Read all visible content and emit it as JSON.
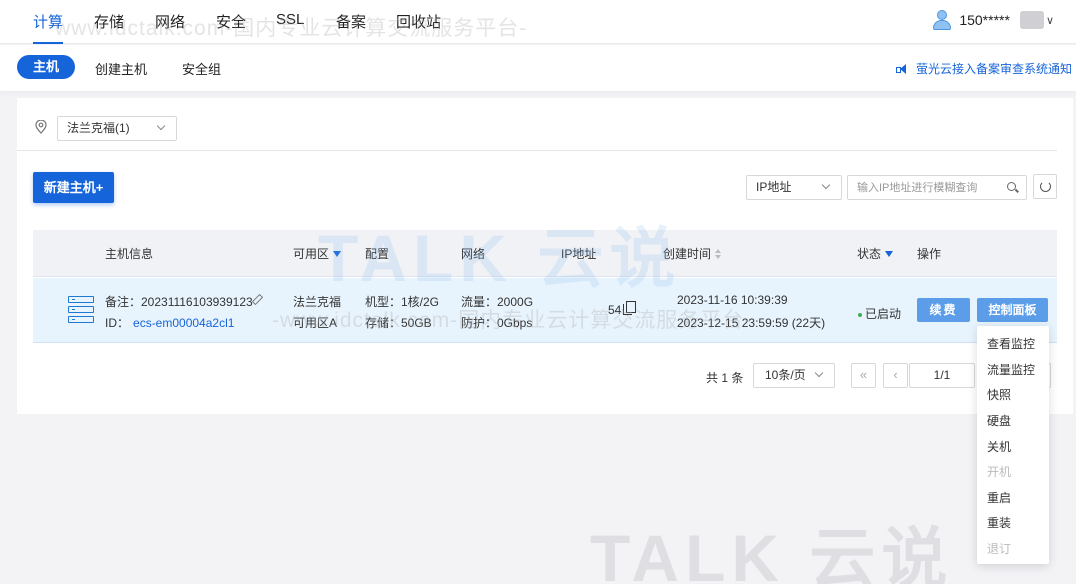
{
  "topnav": {
    "items": [
      {
        "label": "计算",
        "active": true
      },
      {
        "label": "存储"
      },
      {
        "label": "网络"
      },
      {
        "label": "安全"
      },
      {
        "label": "SSL"
      },
      {
        "label": "备案"
      },
      {
        "label": "回收站"
      }
    ],
    "user_name": "150*****",
    "user_icon": "user-icon"
  },
  "subnav": {
    "active_tab": "主机",
    "tabs": [
      "创建主机",
      "安全组"
    ],
    "notice": "萤光云接入备案审查系统通知"
  },
  "region": {
    "selected": "法兰克福(1)"
  },
  "toolbar": {
    "new_button": "新建主机+",
    "ip_type": "IP地址",
    "search_placeholder": "输入IP地址进行模糊查询"
  },
  "table": {
    "headers": {
      "host_info": "主机信息",
      "zone": "可用区",
      "config": "配置",
      "network": "网络",
      "ip": "IP地址",
      "created": "创建时间",
      "status": "状态",
      "actions": "操作"
    },
    "rows": [
      {
        "remark": "备注：20231116103939123",
        "id_label": "ID：",
        "id_value": "ecs-em00004a2cl1",
        "zone_city": "法兰克福",
        "zone_name": "可用区A",
        "config_model": "机型：1核/2G",
        "config_storage": "存储：50GB",
        "net_traffic": "流量：2000G",
        "net_defense": "防护：0Gbps",
        "ip": "54",
        "created": "2023-11-16 10:39:39",
        "expires": "2023-12-15 23:59:59 (22天)",
        "status": "已启动",
        "renew": "续费",
        "control_panel": "控制面板"
      }
    ]
  },
  "pagination": {
    "total": "共 1 条",
    "page_size": "10条/页",
    "first": "«",
    "prev": "‹",
    "page": "1/1"
  },
  "dropdown": {
    "items": [
      {
        "label": "查看监控"
      },
      {
        "label": "流量监控"
      },
      {
        "label": "快照"
      },
      {
        "label": "硬盘"
      },
      {
        "label": "关机"
      },
      {
        "label": "开机",
        "disabled": true
      },
      {
        "label": "重启"
      },
      {
        "label": "重装"
      },
      {
        "label": "退订"
      }
    ]
  },
  "watermark": {
    "text1": "www.idctalk.com-国内专业云计算交流服务平台-",
    "text2": "-www.idctalk.com-国内专业云计算交流服务平台-",
    "logo": "TALK 云说",
    "logo2": "TALK 云说"
  },
  "colors": {
    "accent": "#1664d9",
    "button_light": "#5b9de8",
    "row_highlight": "#e8f4fd",
    "status_ok": "#3fae52"
  }
}
